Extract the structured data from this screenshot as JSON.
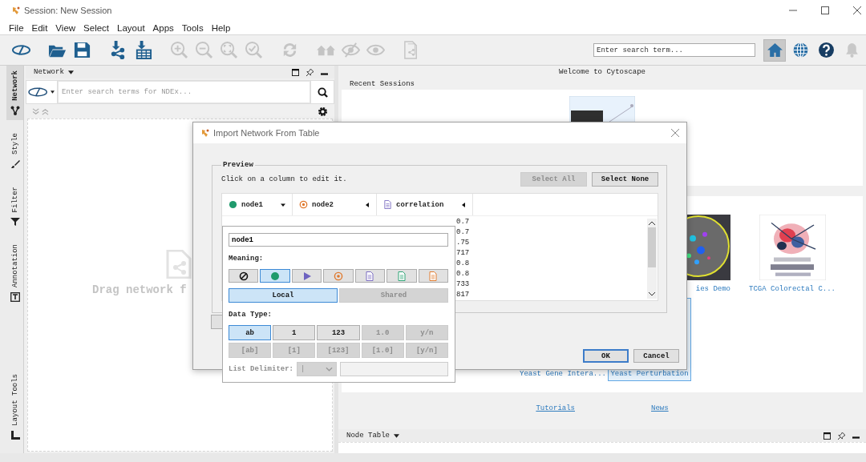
{
  "window": {
    "title": "Session: New Session"
  },
  "menu": [
    "File",
    "Edit",
    "View",
    "Select",
    "Layout",
    "Apps",
    "Tools",
    "Help"
  ],
  "toolbar": {
    "groups": [
      [
        {
          "kind": "ndex",
          "disabled": false
        }
      ],
      [
        {
          "kind": "open",
          "disabled": false
        },
        {
          "kind": "save",
          "disabled": false
        }
      ],
      [
        {
          "kind": "import-network",
          "disabled": false
        },
        {
          "kind": "import-table",
          "disabled": false
        }
      ],
      [
        {
          "kind": "zoom-in",
          "disabled": true
        },
        {
          "kind": "zoom-out",
          "disabled": true
        },
        {
          "kind": "zoom-fit",
          "disabled": true
        },
        {
          "kind": "zoom-selected",
          "disabled": true
        }
      ],
      [
        {
          "kind": "refresh",
          "disabled": true
        }
      ],
      [
        {
          "kind": "show-all",
          "disabled": true
        },
        {
          "kind": "hide",
          "disabled": true
        },
        {
          "kind": "show",
          "disabled": true
        }
      ],
      [
        {
          "kind": "export",
          "disabled": true
        }
      ]
    ],
    "search": {
      "placeholder": "Enter search term..."
    },
    "nav": [
      {
        "kind": "home",
        "selected": true
      },
      {
        "kind": "globe",
        "selected": false
      },
      {
        "kind": "help",
        "selected": false
      },
      {
        "kind": "bell",
        "selected": false
      }
    ]
  },
  "side_tabs": [
    {
      "label": "Network",
      "kind": "network",
      "selected": true
    },
    {
      "label": "Style",
      "kind": "style",
      "selected": false
    },
    {
      "label": "Filter",
      "kind": "filter",
      "selected": false
    },
    {
      "label": "Annotation",
      "kind": "annotation",
      "selected": false
    }
  ],
  "side_tabs_bottom": [
    {
      "label": "Layout Tools",
      "kind": "layout",
      "selected": false
    }
  ],
  "network_panel": {
    "title": "Network",
    "search_placeholder": "Enter search terms for NDEx...",
    "empty_text": "Drag network f"
  },
  "welcome": {
    "title": "Welcome to Cytoscape",
    "recent_label": "Recent Sessions",
    "sample_rows": [
      [
        {
          "label": "ies Demo",
          "kind": "galaxy",
          "selected": false
        },
        {
          "label": "TCGA Colorectal C...",
          "kind": "burst",
          "selected": false
        }
      ],
      [
        {
          "label": "Yeast Gene Intera...",
          "kind": "hidden",
          "selected": false
        },
        {
          "label": "Yeast Perturbation",
          "kind": "hidden",
          "selected": true
        }
      ]
    ],
    "links": [
      "Tutorials",
      "News"
    ]
  },
  "node_table": {
    "title": "Node Table"
  },
  "dialog": {
    "title": "Import Network From Table",
    "group_label": "Preview",
    "hint": "Click on a column to edit it.",
    "buttons": [
      {
        "label": "Select All",
        "disabled": true
      },
      {
        "label": "Select None",
        "disabled": false
      }
    ],
    "columns": [
      {
        "label": "node1",
        "kind": "source",
        "selected": true
      },
      {
        "label": "node2",
        "kind": "target",
        "selected": false
      },
      {
        "label": "correlation",
        "kind": "edge-attr",
        "selected": false
      }
    ],
    "values": [
      "0.7",
      "0.7",
      ".75",
      "717",
      "0.8",
      "0.8",
      "733",
      "817"
    ],
    "actions": [
      {
        "label": "OK",
        "default": true
      },
      {
        "label": "Cancel",
        "default": false
      }
    ]
  },
  "column_editor": {
    "name_value": "node1",
    "meaning_label": "Meaning:",
    "meanings": [
      {
        "kind": "none",
        "selected": false
      },
      {
        "kind": "source",
        "selected": true
      },
      {
        "kind": "interaction",
        "selected": false
      },
      {
        "kind": "target",
        "selected": false
      },
      {
        "kind": "edge-attr",
        "selected": false
      },
      {
        "kind": "source-attr",
        "selected": false
      },
      {
        "kind": "target-attr",
        "selected": false
      }
    ],
    "scopes": [
      {
        "label": "Local",
        "selected": true,
        "disabled": false
      },
      {
        "label": "Shared",
        "selected": false,
        "disabled": true
      }
    ],
    "data_type_label": "Data Type:",
    "data_types": [
      {
        "label": "ab",
        "selected": true,
        "disabled": false
      },
      {
        "label": "1",
        "selected": false,
        "disabled": false
      },
      {
        "label": "123",
        "selected": false,
        "disabled": false
      },
      {
        "label": "1.0",
        "selected": false,
        "disabled": true
      },
      {
        "label": "y/n",
        "selected": false,
        "disabled": true
      },
      {
        "label": "[ab]",
        "selected": false,
        "disabled": true
      },
      {
        "label": "[1]",
        "selected": false,
        "disabled": true
      },
      {
        "label": "[123]",
        "selected": false,
        "disabled": true
      },
      {
        "label": "[1.0]",
        "selected": false,
        "disabled": true
      },
      {
        "label": "[y/n]",
        "selected": false,
        "disabled": true
      }
    ],
    "list_delimiter": {
      "label": "List Delimiter:",
      "value": "|",
      "disabled": true
    }
  }
}
